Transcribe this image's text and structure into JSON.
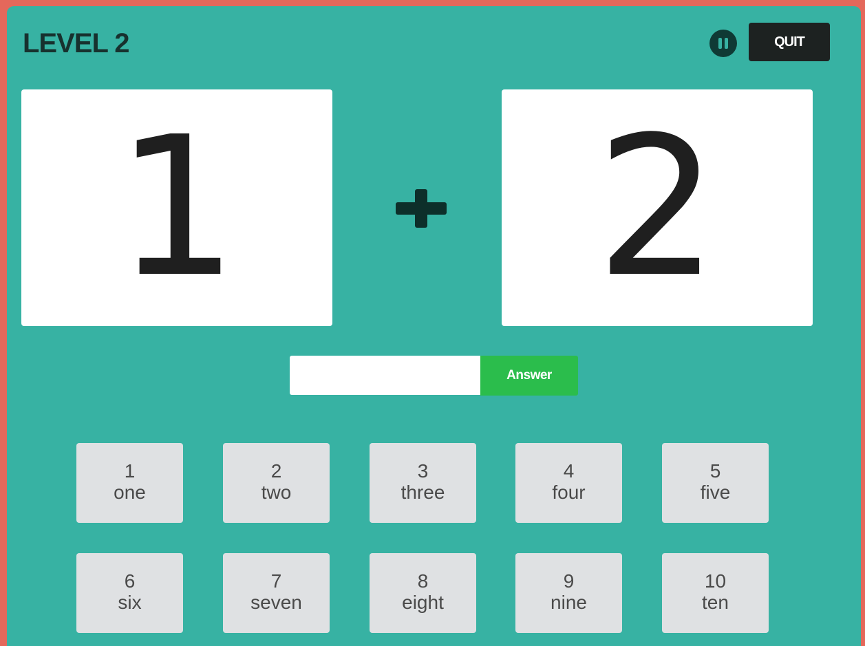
{
  "header": {
    "level_title": "LEVEL 2",
    "quit_label": "QUIT"
  },
  "problem": {
    "left_number": "1",
    "operator": "plus",
    "right_number": "2"
  },
  "answer": {
    "input_value": "",
    "button_label": "Answer"
  },
  "keypad": [
    {
      "digit": "1",
      "word": "one"
    },
    {
      "digit": "2",
      "word": "two"
    },
    {
      "digit": "3",
      "word": "three"
    },
    {
      "digit": "4",
      "word": "four"
    },
    {
      "digit": "5",
      "word": "five"
    },
    {
      "digit": "6",
      "word": "six"
    },
    {
      "digit": "7",
      "word": "seven"
    },
    {
      "digit": "8",
      "word": "eight"
    },
    {
      "digit": "9",
      "word": "nine"
    },
    {
      "digit": "10",
      "word": "ten"
    }
  ],
  "icons": {
    "pause": "pause-icon",
    "operator": "plus-icon"
  },
  "colors": {
    "background": "#37b2a3",
    "accent_frame": "#e4685b",
    "answer_button": "#2bbd4c",
    "quit_button": "#1d2221",
    "key_background": "#dfe1e3"
  }
}
